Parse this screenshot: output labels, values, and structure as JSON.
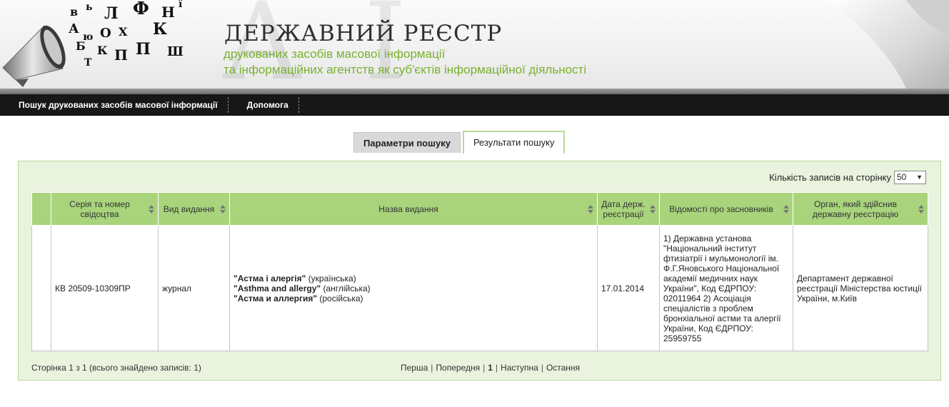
{
  "header": {
    "title": "ДЕРЖАВНИЙ РЕЄСТР",
    "subtitle_line1": "друкованих засобів масової інформації",
    "subtitle_line2": "та інформаційних агентств як суб'єктів інформаційної діяльності"
  },
  "nav": {
    "items": [
      {
        "label": "Пошук друкованих засобів масової інформації"
      },
      {
        "label": "Допомога"
      }
    ]
  },
  "tabs": {
    "params": "Параметри пошуку",
    "results": "Результати пошуку"
  },
  "perpage": {
    "label": "Кількість записів на сторінку",
    "value": "50"
  },
  "table": {
    "headers": {
      "cert": "Серія та номер свідоцтва",
      "type": "Вид видання",
      "name": "Назва видання",
      "date": "Дата держ. реєстрації",
      "founders": "Відомості про засновників",
      "registrar": "Орган, який здійснив державну реєстрацію"
    },
    "rows": [
      {
        "cert": "КВ 20509-10309ПР",
        "type": "журнал",
        "titles": [
          {
            "title": "\"Астма і алергія\"",
            "lang": "(українська)"
          },
          {
            "title": "\"Asthma and allergy\"",
            "lang": "(англійська)"
          },
          {
            "title": "\"Астма и аллергия\"",
            "lang": "(російська)"
          }
        ],
        "date": "17.01.2014",
        "founders": "1) Державна установа \"Національний інститут фтизіатрії і мульмонології ім. Ф.Г.Яновського Національної академії медичних наук України\", Код ЄДРПОУ: 02011964 2) Асоціація спеціалістів з проблем бронхіальної астми та алергії України, Код ЄДРПОУ: 25959755",
        "registrar": "Департамент державної реєстрації Міністерства юстиції України, м.Київ"
      }
    ]
  },
  "footer": {
    "info": "Сторінка 1 з 1 (всього знайдено записів: 1)"
  },
  "pager": {
    "first": "Перша",
    "prev": "Попередня",
    "current": "1",
    "next": "Наступна",
    "last": "Остання"
  },
  "icons": {
    "logo": "megaphone-letters-icon",
    "sort": "sort-arrows-icon",
    "dropdown": "chevron-down-icon"
  },
  "colors": {
    "accent_green": "#79b12e",
    "header_green": "#a9d47c",
    "panel_bg": "#e9f3dd",
    "nav_bg": "#171717"
  }
}
